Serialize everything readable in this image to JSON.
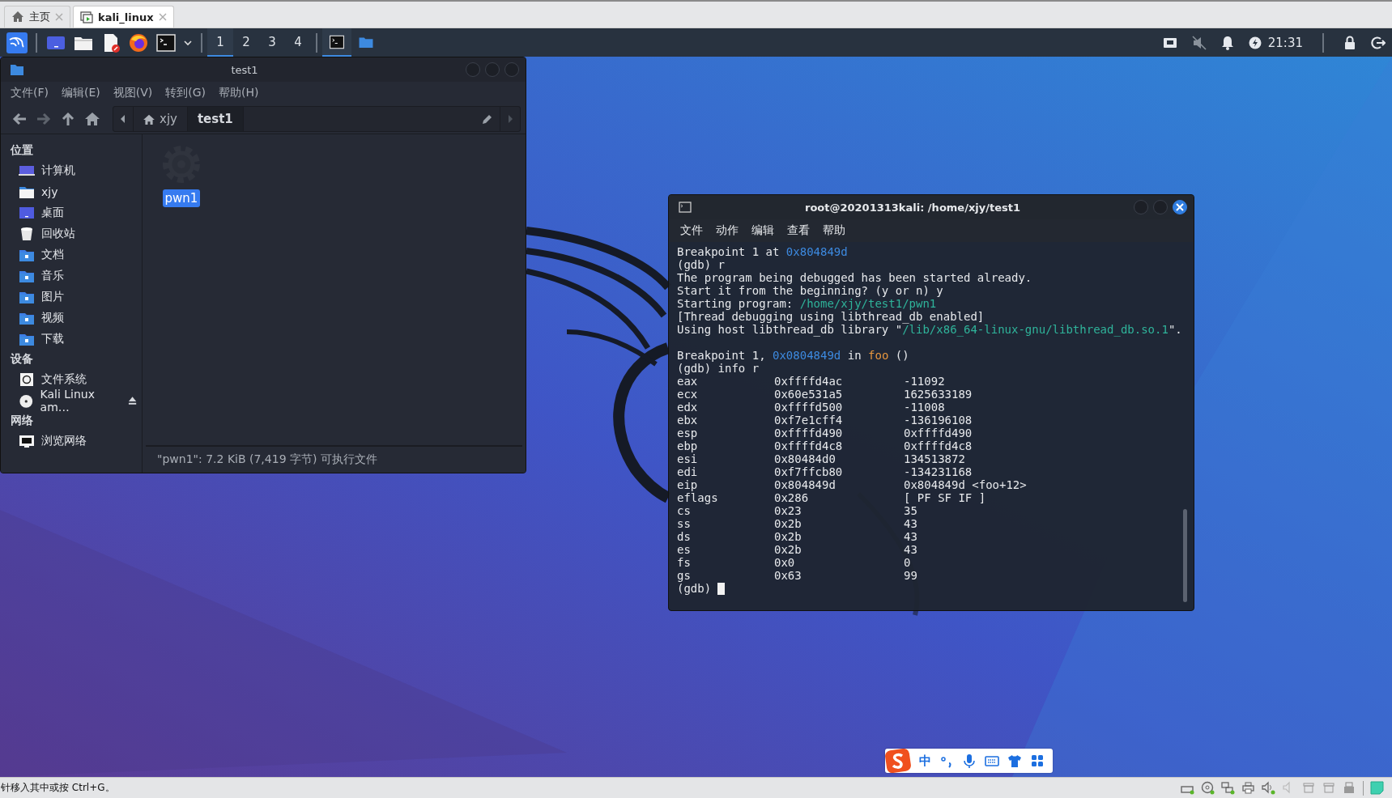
{
  "vm_tabs": [
    {
      "label": "主页",
      "kind": "home",
      "selected": false
    },
    {
      "label": "kali_linux",
      "kind": "vm",
      "selected": true
    }
  ],
  "panel": {
    "launchers": [
      {
        "kind": "desktop"
      },
      {
        "kind": "folder"
      },
      {
        "kind": "editor"
      },
      {
        "kind": "browser"
      },
      {
        "kind": "terminal"
      }
    ],
    "workspaces": [
      {
        "label": "1",
        "selected": true
      },
      {
        "label": "2",
        "selected": false
      },
      {
        "label": "3",
        "selected": false
      },
      {
        "label": "4",
        "selected": false
      }
    ],
    "tasks": [
      {
        "kind": "terminal",
        "selected": true
      },
      {
        "kind": "folder",
        "selected": false
      }
    ],
    "clock": "21:31"
  },
  "file_manager": {
    "title": "test1",
    "menu": [
      "文件(F)",
      "编辑(E)",
      "视图(V)",
      "转到(G)",
      "帮助(H)"
    ],
    "breadcrumb": [
      {
        "label": "xjy",
        "kind": "home",
        "selected": false
      },
      {
        "label": "test1",
        "kind": "folder",
        "selected": true
      }
    ],
    "sidebar": [
      {
        "heading": "位置",
        "items": [
          {
            "label": "计算机",
            "kind": "computer"
          },
          {
            "label": "xjy",
            "kind": "home"
          },
          {
            "label": "桌面",
            "kind": "desktop"
          },
          {
            "label": "回收站",
            "kind": "trash"
          },
          {
            "label": "文档",
            "kind": "folder"
          },
          {
            "label": "音乐",
            "kind": "folder"
          },
          {
            "label": "图片",
            "kind": "folder"
          },
          {
            "label": "视频",
            "kind": "folder"
          },
          {
            "label": "下载",
            "kind": "folder"
          }
        ]
      },
      {
        "heading": "设备",
        "items": [
          {
            "label": "文件系统",
            "kind": "drive"
          },
          {
            "label": "Kali Linux am…",
            "kind": "disc"
          }
        ]
      },
      {
        "heading": "网络",
        "items": [
          {
            "label": "浏览网络",
            "kind": "network"
          }
        ]
      }
    ],
    "files": [
      {
        "name": "pwn1",
        "selected": true
      }
    ],
    "status": "\"pwn1\": 7.2 KiB (7,419 字节) 可执行文件"
  },
  "terminal": {
    "title": "root@20201313kali: /home/xjy/test1",
    "menu": [
      "文件",
      "动作",
      "编辑",
      "查看",
      "帮助"
    ],
    "blocks": [
      [
        [
          {
            "text": "Breakpoint 1 at ",
            "kind": "plain"
          },
          {
            "text": "0x804849d",
            "kind": "address"
          }
        ],
        [
          {
            "text": "(gdb) r",
            "kind": "plain"
          }
        ],
        [
          {
            "text": "The program being debugged has been started already.",
            "kind": "plain"
          }
        ],
        [
          {
            "text": "Start it from the beginning? (y or n) y",
            "kind": "plain"
          }
        ],
        [
          {
            "text": "Starting program: ",
            "kind": "plain"
          },
          {
            "text": "/home/xjy/test1/pwn1",
            "kind": "path"
          }
        ],
        [
          {
            "text": "[Thread debugging using libthread_db enabled]",
            "kind": "plain"
          }
        ],
        [
          {
            "text": "Using host libthread_db library \"",
            "kind": "plain"
          },
          {
            "text": "/lib/x86_64-linux-gnu/libthread_db.so.1",
            "kind": "path"
          },
          {
            "text": "\".",
            "kind": "plain"
          }
        ]
      ],
      [
        [
          {
            "text": "Breakpoint 1, ",
            "kind": "plain"
          },
          {
            "text": "0x0804849d",
            "kind": "address"
          },
          {
            "text": " in ",
            "kind": "plain"
          },
          {
            "text": "foo",
            "kind": "function"
          },
          {
            "text": " ()",
            "kind": "plain"
          }
        ],
        [
          {
            "text": "(gdb) info r",
            "kind": "plain"
          }
        ]
      ]
    ],
    "registers": [
      {
        "name": "eax",
        "hex": "0xffffd4ac",
        "value": "-11092"
      },
      {
        "name": "ecx",
        "hex": "0x60e531a5",
        "value": "1625633189"
      },
      {
        "name": "edx",
        "hex": "0xffffd500",
        "value": "-11008"
      },
      {
        "name": "ebx",
        "hex": "0xf7e1cff4",
        "value": "-136196108"
      },
      {
        "name": "esp",
        "hex": "0xffffd490",
        "value": "0xffffd490"
      },
      {
        "name": "ebp",
        "hex": "0xffffd4c8",
        "value": "0xffffd4c8"
      },
      {
        "name": "esi",
        "hex": "0x80484d0",
        "value": "134513872"
      },
      {
        "name": "edi",
        "hex": "0xf7ffcb80",
        "value": "-134231168"
      },
      {
        "name": "eip",
        "hex": "0x804849d",
        "value": "0x804849d <foo+12>"
      },
      {
        "name": "eflags",
        "hex": "0x286",
        "value": "[ PF SF IF ]"
      },
      {
        "name": "cs",
        "hex": "0x23",
        "value": "35"
      },
      {
        "name": "ss",
        "hex": "0x2b",
        "value": "43"
      },
      {
        "name": "ds",
        "hex": "0x2b",
        "value": "43"
      },
      {
        "name": "es",
        "hex": "0x2b",
        "value": "43"
      },
      {
        "name": "fs",
        "hex": "0x0",
        "value": "0"
      },
      {
        "name": "gs",
        "hex": "0x63",
        "value": "99"
      }
    ],
    "prompt": "(gdb)"
  },
  "ime": {
    "mode": "中"
  },
  "status_bar": {
    "hint": "针移入其中或按 Ctrl+G。"
  }
}
